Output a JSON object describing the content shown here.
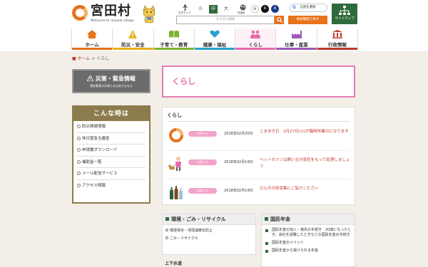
{
  "header": {
    "logo_name": "宮田村",
    "logo_sub": "Welcome to miyada village",
    "accessibility_label": "文字サイズ",
    "font_sizes": [
      "小",
      "中",
      "大"
    ],
    "color_label": "背景色",
    "color_options": [
      "A",
      "A",
      "A"
    ],
    "translate_label": "言語を選択",
    "search_placeholder": "カスタム検索",
    "gen_link": "検索機能で探す",
    "sitemap_label": "サイトマップ"
  },
  "gnav": [
    {
      "label": "ホーム",
      "icon": "house-icon",
      "color": "#e8731a"
    },
    {
      "label": "防災・安全",
      "icon": "warning-icon",
      "color": "#e8b01a"
    },
    {
      "label": "子育て・教育",
      "icon": "book-icon",
      "color": "#7bb32e"
    },
    {
      "label": "健康・福祉",
      "icon": "heart-icon",
      "color": "#2aa0c9"
    },
    {
      "label": "くらし",
      "icon": "people-icon",
      "color": "#e56aa8"
    },
    {
      "label": "仕事・産業",
      "icon": "factory-icon",
      "color": "#9b59b6"
    },
    {
      "label": "行政情報",
      "icon": "building-icon",
      "color": "#c0392b"
    }
  ],
  "breadcrumb": {
    "home": "ホーム",
    "sep": ">",
    "current": "くらし"
  },
  "disaster": {
    "title": "災害・緊急情報",
    "sub": "現在緊急のお知らせはありません"
  },
  "konna": {
    "title": "こんな時は",
    "items": [
      "防災関連情報",
      "休日緊急当番医",
      "申請書ダウンロード",
      "補助金一覧",
      "メール配信サービス",
      "アクセス情報"
    ]
  },
  "page_title": "くらし",
  "news": {
    "heading": "くらし",
    "items": [
      {
        "badge": "お知らせ",
        "date": "2018年02月20日",
        "title": "こまゆき日　2月27日(火)が臨時休業日になります"
      },
      {
        "badge": "お知らせ",
        "date": "2018年02月14日",
        "title": "ペットのフンは飼い主が責任をもって処理しましょう"
      },
      {
        "badge": "お知らせ",
        "date": "2018年02月14日",
        "title": "びんの分別収集にご協力ください"
      }
    ]
  },
  "card_left": {
    "title": "環境・ごみ・リサイクル",
    "items": [
      "環境保全・地球温暖化防止",
      "ごみ・リサイクル"
    ]
  },
  "card_right": {
    "title": "国民年金",
    "items": [
      "国民年金の加入・喪失の手続き　20歳になったとき、会社を退職したときなどの国民年金の手続き",
      "国民年金のメリット",
      "国民年金から受けられる年金"
    ]
  },
  "extra_head": "上下水道"
}
